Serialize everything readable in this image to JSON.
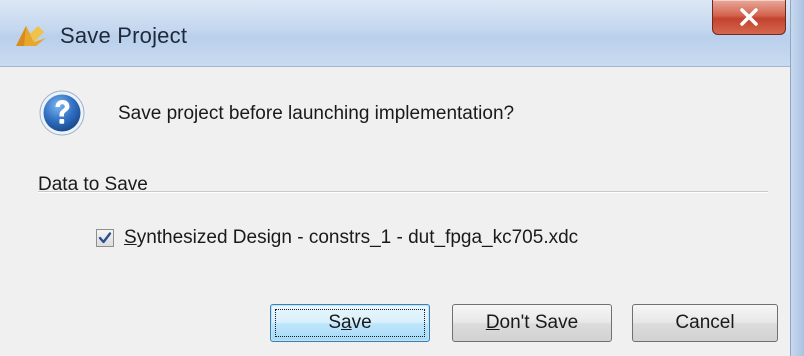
{
  "window": {
    "title": "Save Project",
    "app_icon": "vivado-logo-icon",
    "close_icon": "close-icon"
  },
  "message": {
    "icon": "question-icon",
    "text": "Save project before launching implementation?"
  },
  "section": {
    "label": "Data to Save"
  },
  "items": [
    {
      "checked": true,
      "label_first": "S",
      "label_rest": "ynthesized Design - constrs_1 - dut_fpga_kc705.xdc"
    }
  ],
  "buttons": {
    "save": {
      "pre": "S",
      "mnemonic": "a",
      "post": "ve"
    },
    "dont_save": {
      "mnemonic": "D",
      "post": "on't Save"
    },
    "cancel": {
      "label": "Cancel"
    }
  },
  "colors": {
    "title_bar": "#c4d7ef",
    "close_button": "#c2432d",
    "client_background": "#f0f0f0",
    "default_button": "#bee6fd"
  }
}
